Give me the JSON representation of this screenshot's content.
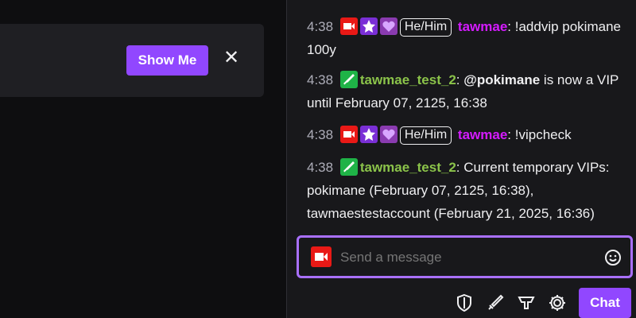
{
  "banner": {
    "show_me_label": "Show Me",
    "close_glyph": "✕"
  },
  "chat": {
    "messages": [
      {
        "time": "4:38",
        "badges": [
          "broadcaster-icon",
          "star-icon",
          "heart-icon"
        ],
        "pronoun": "He/Him",
        "user": "tawmae",
        "text": "!addvip pokimane 100y"
      },
      {
        "time": "4:38",
        "badges": [
          "moderator-sword-icon"
        ],
        "user": "tawmae_test_2",
        "mention": "@pokimane",
        "text": " is now a VIP until February 07, 2125, 16:38"
      },
      {
        "time": "4:38",
        "badges": [
          "broadcaster-icon",
          "star-icon",
          "heart-icon"
        ],
        "pronoun": "He/Him",
        "user": "tawmae",
        "text": "!vipcheck"
      },
      {
        "time": "4:38",
        "badges": [
          "moderator-sword-icon"
        ],
        "user": "tawmae_test_2",
        "text": "Current temporary VIPs: pokimane (February 07, 2125, 16:38), tawmaestestaccount (February 21, 2025, 16:36)"
      }
    ],
    "input": {
      "placeholder": "Send a message"
    },
    "send_label": "Chat"
  },
  "colors": {
    "accent": "#9147ff",
    "focus_border": "#a970ff",
    "broadcaster_red": "#e91916",
    "user_pink": "#d41bff",
    "user_green": "#8bc34a",
    "mod_green": "#1fb347"
  },
  "icons": [
    "shield-icon",
    "sword-icon",
    "crown-icon",
    "gear-icon",
    "emoji-icon",
    "close-icon"
  ]
}
